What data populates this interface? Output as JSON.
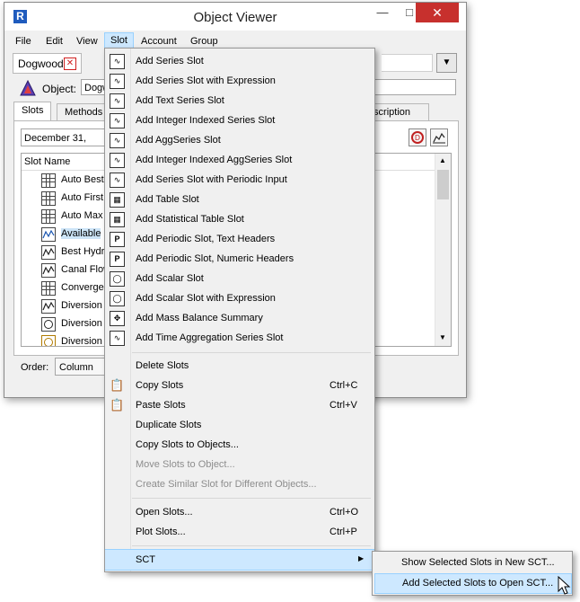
{
  "window": {
    "title": "Object Viewer",
    "logo": "R"
  },
  "menubar": [
    "File",
    "Edit",
    "View",
    "Slot",
    "Account",
    "Group"
  ],
  "object_tab": {
    "label": "Dogwood"
  },
  "object": {
    "label": "Object:",
    "value": "Dogwood"
  },
  "panel_tabs": [
    "Slots",
    "Methods",
    "Description"
  ],
  "date_value": "December 31, 2017",
  "list": {
    "header": "Slot Name",
    "rows": [
      {
        "icon": "table",
        "label": "Auto Best"
      },
      {
        "icon": "table",
        "label": "Auto First"
      },
      {
        "icon": "table",
        "label": "Auto Max"
      },
      {
        "icon": "series",
        "label": "Available"
      },
      {
        "icon": "series",
        "label": "Best Hydr"
      },
      {
        "icon": "series",
        "label": "Canal Flow"
      },
      {
        "icon": "table",
        "label": "Converge"
      },
      {
        "icon": "series",
        "label": "Diversion"
      },
      {
        "icon": "expression",
        "label": "Diversion"
      },
      {
        "icon": "expression",
        "label": "Diversion"
      }
    ]
  },
  "order": {
    "label": "Order:",
    "value": "Column Sort"
  },
  "slot_menu": {
    "group1": [
      {
        "label": "Add Series Slot",
        "icon": "series-slot-icon"
      },
      {
        "label": "Add Series Slot with Expression",
        "icon": "series-expression-icon"
      },
      {
        "label": "Add Text Series Slot",
        "icon": "text-series-icon"
      },
      {
        "label": "Add Integer Indexed Series Slot",
        "icon": "integer-series-icon"
      },
      {
        "label": "Add AggSeries Slot",
        "icon": "agg-series-icon"
      },
      {
        "label": "Add Integer Indexed AggSeries Slot",
        "icon": "integer-agg-series-icon"
      },
      {
        "label": "Add Series Slot with Periodic Input",
        "icon": "periodic-input-icon"
      },
      {
        "label": "Add Table Slot",
        "icon": "table-slot-icon"
      },
      {
        "label": "Add Statistical Table Slot",
        "icon": "statistical-table-icon"
      },
      {
        "label": "Add Periodic Slot, Text Headers",
        "icon": "periodic-text-icon"
      },
      {
        "label": "Add Periodic Slot, Numeric Headers",
        "icon": "periodic-numeric-icon"
      },
      {
        "label": "Add Scalar Slot",
        "icon": "scalar-slot-icon"
      },
      {
        "label": "Add Scalar Slot with Expression",
        "icon": "scalar-expression-icon"
      },
      {
        "label": "Add Mass Balance Summary",
        "icon": "mass-balance-icon"
      },
      {
        "label": "Add Time Aggregation Series Slot",
        "icon": "time-aggregation-icon"
      }
    ],
    "group2": [
      {
        "label": "Delete Slots",
        "shortcut": "",
        "disabled": false,
        "icon": ""
      },
      {
        "label": "Copy Slots",
        "shortcut": "Ctrl+C",
        "disabled": false,
        "icon": "copy-icon"
      },
      {
        "label": "Paste Slots",
        "shortcut": "Ctrl+V",
        "disabled": false,
        "icon": "paste-icon"
      },
      {
        "label": "Duplicate Slots",
        "shortcut": "",
        "disabled": false,
        "icon": ""
      },
      {
        "label": "Copy Slots to Objects...",
        "shortcut": "",
        "disabled": false,
        "icon": ""
      },
      {
        "label": "Move Slots to Object...",
        "shortcut": "",
        "disabled": true,
        "icon": ""
      },
      {
        "label": "Create Similar Slot for Different Objects...",
        "shortcut": "",
        "disabled": true,
        "icon": ""
      }
    ],
    "group3": [
      {
        "label": "Open Slots...",
        "shortcut": "Ctrl+O"
      },
      {
        "label": "Plot Slots...",
        "shortcut": "Ctrl+P"
      }
    ],
    "sct": "SCT"
  },
  "sct_submenu": [
    "Show Selected Slots in New SCT...",
    "Add Selected Slots to Open SCT..."
  ]
}
